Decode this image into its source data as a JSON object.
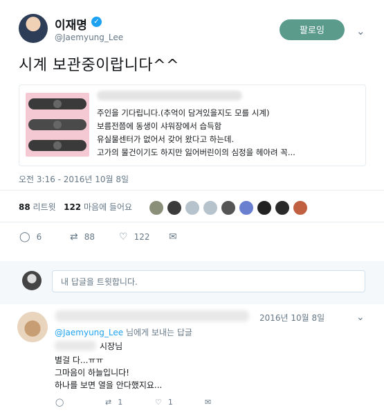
{
  "tweet": {
    "author": "이재명",
    "handle": "@Jaemyung_Lee",
    "follow_label": "팔로잉",
    "text": "시계 보관중이랍니다^^",
    "card": {
      "lines": [
        "주인을 기다립니다.(추억이 담겨있을지도 모를 시계)",
        "보름전쯤에 동생이 샤워장에서 습득함",
        "유실물센터가 없어서 갖어 왔다고 하는데.",
        "고가의 물건이기도 하지만 잃어버린이의 심정을 헤아려 꼭..."
      ]
    },
    "timestamp": "오전 3:16 - 2016년 10월 8일",
    "retweets_count": "88",
    "retweets_label": "리트윗",
    "likes_count": "122",
    "likes_label": "마음에 들어요",
    "actions": {
      "reply": "6",
      "retweet": "88",
      "like": "122"
    }
  },
  "reply_box": {
    "placeholder": "내 답글을 트윗합니다."
  },
  "reply": {
    "date": "2016년 10월 8일",
    "handle": "@Jaemyung_Lee",
    "to_label": "님에게 보내는 답글",
    "lines": [
      "시장님",
      "별걸 다...ㅠㅠ",
      "그마음이 하늘입니다!",
      "하나를 보면 열을 안다했지요..."
    ],
    "actions": {
      "reply": "",
      "retweet": "1",
      "like": "1"
    }
  },
  "colors": {
    "follow_bg": "#5b9b8c",
    "verified": "#1da1f2",
    "muted": "#657786"
  }
}
